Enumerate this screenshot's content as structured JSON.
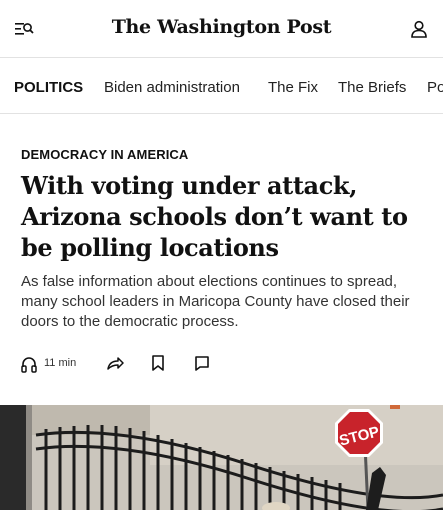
{
  "header": {
    "logo_text": "The Washington Post",
    "menu_icon": "sections-menu-icon",
    "account_icon": "user-account-icon"
  },
  "section_nav": {
    "items": [
      {
        "label": "POLITICS",
        "active": true
      },
      {
        "label": "Biden administration",
        "active": false
      },
      {
        "label": "The Fix",
        "active": false
      },
      {
        "label": "The Briefs",
        "active": false
      },
      {
        "label": "Po",
        "active": false
      }
    ]
  },
  "article": {
    "kicker": "DEMOCRACY IN AMERICA",
    "headline": "With voting under attack, Arizona schools don’t want to be polling locations",
    "dek": "As false information about elections continues to spread, many school leaders in Maricopa County have closed their doors to the democratic process.",
    "listen_time": "11 min",
    "stop_sign_text": "STOP"
  },
  "colors": {
    "text": "#111111",
    "divider": "#e2e2e2",
    "stop_red": "#c8232b"
  }
}
